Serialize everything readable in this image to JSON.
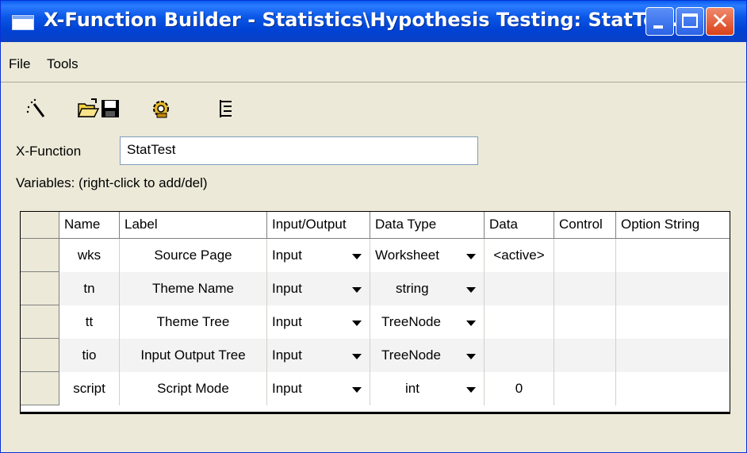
{
  "window": {
    "title": "X-Function Builder - Statistics\\Hypothesis Testing: StatTe..."
  },
  "menu": [
    "File",
    "Tools"
  ],
  "toolbar": {
    "icons": [
      "wizard-icon",
      "open-folder-icon",
      "save-icon",
      "compile-gear-icon",
      "tree-view-icon"
    ]
  },
  "xfunction": {
    "label": "X-Function",
    "value": "StatTest"
  },
  "variables_label": "Variables: (right-click to add/del)",
  "grid": {
    "headers": [
      "Name",
      "Label",
      "Input/Output",
      "Data Type",
      "Data",
      "Control",
      "Option String"
    ],
    "rows": [
      {
        "name": "wks",
        "label": "Source Page",
        "io": "Input",
        "type": "Worksheet",
        "data": "<active>",
        "control": "",
        "option": ""
      },
      {
        "name": "tn",
        "label": "Theme Name",
        "io": "Input",
        "type": "string",
        "data": "",
        "control": "",
        "option": ""
      },
      {
        "name": "tt",
        "label": "Theme Tree",
        "io": "Input",
        "type": "TreeNode",
        "data": "",
        "control": "",
        "option": ""
      },
      {
        "name": "tio",
        "label": "Input Output Tree",
        "io": "Input",
        "type": "TreeNode",
        "data": "",
        "control": "",
        "option": ""
      },
      {
        "name": "script",
        "label": "Script Mode",
        "io": "Input",
        "type": "int",
        "data": "0",
        "control": "",
        "option": ""
      }
    ]
  },
  "colors": {
    "titlebar": "#0a56e6",
    "face": "#ece9d8",
    "alt_row": "#f3f3f3"
  }
}
